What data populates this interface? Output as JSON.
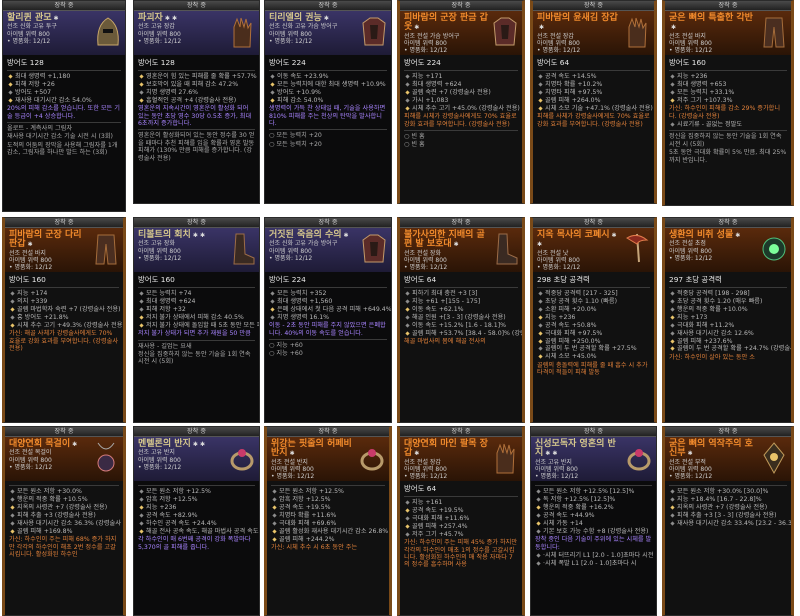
{
  "tab_label": "장착 중",
  "colors": {
    "unique": "#d4c68c",
    "legendary": "#f08a2c",
    "good": "#e8c46a",
    "aspect": "#e0803a",
    "blue": "#6aa8ff"
  },
  "cards": [
    {
      "name": "할리퀸 관모",
      "stars": "✱",
      "rarity": "u",
      "icon": "helm-icon",
      "sub": [
        "선조 신화 고유 투구",
        "아이템 위력 800",
        "• 명품화: 12/12"
      ],
      "armor": "방어도 128",
      "stats": [
        [
          "g",
          "최대 생명력 +1,180"
        ],
        [
          "g",
          "피해 저항 +26"
        ],
        [
          "",
          "방어도 +507"
        ],
        [
          "g",
          "재사용 대기시간 감소 54.0%"
        ],
        [
          "asp",
          "20%의 피해 감소를 얻습니다. 또한 모든 기술 등급이 +4 상승합니다."
        ]
      ],
      "extra": [
        "올로트 - 계측사의 그림자",
        "재사용 대기시간 감소 기술 시전 시 (3회)",
        "도적의 어둠의 장막을 사용해 그림자를 1개 감소, 그림자를 하나만 발드 하는 (3회)"
      ]
    },
    {
      "name": "파괴자",
      "stars": "✱ ✱",
      "rarity": "u",
      "icon": "glove-icon",
      "sub": [
        "선조 고유 장갑",
        "아이템 위력 800",
        "• 명품화: 12/12"
      ],
      "armor": "방어도 128",
      "stats": [
        [
          "g",
          "영혼운이 힘 있는 피해를 줄 확률 +57.7% (강령술사 전용)"
        ],
        [
          "g",
          "보호막이 있을 때 피해 감소 47.2%"
        ],
        [
          "",
          "치명 생명력 27.6%"
        ],
        [
          "g",
          "흡혈적인 공격 +4 (강령술사 전용)"
        ],
        [
          "asp",
          "영혼운의 지속시간이 영혼운이 활성화 되어 있는 동안 초당 영수 30당 0.5초 증가, 최대 6초까지 증가합니다."
        ]
      ],
      "extra": [
        "영혼운이 활성화되어 있는 동안 정수를 30 얻을 때마다 추천 피해를 입을 확률과 영혼 발동 피해가 (130% 만큼 피해를 증가합니다. (강령술사 전용)"
      ]
    },
    {
      "name": "티리엘의 권능",
      "stars": "✱",
      "rarity": "u",
      "icon": "armor-icon",
      "sub": [
        "선조 신화 고유 가슴 방어구",
        "아이템 위력 800",
        "• 명품화: 12/12"
      ],
      "armor": "방어도 224",
      "stats": [
        [
          "",
          "이동 속도 +23.9%"
        ],
        [
          "g",
          "모든 능력치에 대한 최대 생명력 +10.9%"
        ],
        [
          "",
          "방어도 +10.9%"
        ],
        [
          "g",
          "피해 감소 54.0%"
        ],
        [
          "asp",
          "생명력이 가득 찬 상태일 때, 기술을 사용하면 810% 피해를 주는 천상의 탄막을 발사합니다."
        ]
      ],
      "extra": [
        "○ 모든 능력치 +20",
        "○ 모든 능력치 +20"
      ]
    },
    {
      "name": "피바람의 군장 판금 갑옷",
      "stars": "✱",
      "rarity": "l",
      "icon": "armor-icon",
      "sub": [
        "선조 전설 가슴 방어구",
        "아이템 위력 800",
        "• 명품화: 12/12"
      ],
      "armor": "방어도 224",
      "stats": [
        [
          "",
          "지능 +171"
        ],
        [
          "",
          "최대 생명력 +624"
        ],
        [
          "g",
          "골렘 숙련 +7 (강령술사 전용)"
        ],
        [
          "",
          "가시 +1,083"
        ],
        [
          "g",
          "시체 추수 고기 +45.0% (강령술사 전용)"
        ],
        [
          "asp",
          "피해를 시체가 강령술사에게도 70% 효율로 강화 효과를 부여합니다. (강령술사 전용)"
        ]
      ],
      "extra": [
        "○ 빈 홈",
        "○ 빈 홈"
      ]
    },
    {
      "name": "피바람의 윤새김 장갑",
      "stars": "✱",
      "rarity": "l",
      "icon": "glove-icon",
      "sub": [
        "선조 전설 장갑",
        "아이템 위력 800",
        "• 명품화: 12/12"
      ],
      "armor": "방어도 64",
      "stats": [
        [
          "",
          "공격 속도 +14.5%"
        ],
        [
          "",
          "치명타 확률 +10.2%"
        ],
        [
          "",
          "치명타 피해 +97.5%"
        ],
        [
          "g",
          "골렘 피해 +264.0%"
        ],
        [
          "g",
          "시체 소모 기술 +47.1% (강령술사 전용)"
        ],
        [
          "asp",
          "피해를 사체가 강령술사에게도 70% 효율로 강화 효과를 부여합니다. (강령술사 전용)"
        ]
      ],
      "extra": []
    },
    {
      "name": "굳은 뼈의 특출한 각반",
      "stars": "✱",
      "rarity": "l",
      "icon": "pants-icon",
      "sub": [
        "선조 전설 바지",
        "아이템 위력 800",
        "• 명품화: 12/12"
      ],
      "armor": "방어도 160",
      "stats": [
        [
          "",
          "지능 +236"
        ],
        [
          "",
          "최대 생명력 +653"
        ],
        [
          "",
          "모든 능력치 +33.1%"
        ],
        [
          "g",
          "저주 그기 +107.3%"
        ],
        [
          "asp",
          "가신: 하수인이 피해를 감소 29% 증가합니다. (강령술사 전용)"
        ],
        [
          "",
          "시료기류 - 골없는 정말도"
        ]
      ],
      "extra": [
        "정신을 집중하지 않는 동안 기술을 1회 연속 시전 시 (5회)",
        "5초 동안 극대화 확률이 5% 만큼, 최대 25%까지 반입니다."
      ]
    },
    {
      "name": "피바람의 군장 다리 판갑",
      "stars": "✱",
      "rarity": "l",
      "icon": "pants-icon",
      "sub": [
        "선조 전설 바지",
        "아이템 위력 800",
        "• 명품화: 12/12"
      ],
      "armor": "방어도 160",
      "stats": [
        [
          "",
          "지능 +174"
        ],
        [
          "",
          "의지 +339"
        ],
        [
          "g",
          "골렘 마법학자 숙련 +7 (강령술사 전용)"
        ],
        [
          "",
          "흉 방어도 +21.8%"
        ],
        [
          "g",
          "시체 추수 고기 +49.3% (강령술사 전용)"
        ],
        [
          "asp",
          "가신: 해골 사체가 강령술사에게도 70% 효율로 강화 효과를 부여합니다. (강령술사 전용)"
        ]
      ],
      "extra": []
    },
    {
      "name": "티볼트의 회치",
      "stars": "✱ ✱",
      "rarity": "u",
      "icon": "boot-icon",
      "sub": [
        "선조 고유 장화",
        "아이템 위력 800",
        "• 명품화: 12/12"
      ],
      "armor": "방어도 160",
      "stats": [
        [
          "",
          "모든 능력치 +74"
        ],
        [
          "",
          "최대 생명력 +624"
        ],
        [
          "",
          "피해 저항 +32"
        ],
        [
          "g",
          "저지 불가 상태에서 피해 감소 40.5%"
        ],
        [
          "g",
          "저지 불가 상태에 돌입할 때 5초 동안 모든 피해가 20% 증가합니다."
        ],
        [
          "asp",
          "저지 불가 상태가 되면 추가 재원을 50 만큼"
        ]
      ],
      "extra": [
        "재사용 - 길업는 요새",
        "정신을 집중하지 않는 동안 기술을 1회 연속 시전 시 (5회)"
      ]
    },
    {
      "name": "거짓된 죽음의 수의",
      "stars": "✱",
      "rarity": "u",
      "icon": "armor-icon",
      "sub": [
        "선조 신화 고유 가슴 방어구",
        "아이템 위력 800",
        "• 명품화: 12/12"
      ],
      "armor": "방어도 224",
      "stats": [
        [
          "",
          "모든 능력치 +352"
        ],
        [
          "",
          "최대 생명력 +1,560"
        ],
        [
          "g",
          "은폐 상태에서 첫 다음 공격 피해 +649.4%"
        ],
        [
          "",
          "치명 생명력 16.1%"
        ],
        [
          "asp",
          "이동 - 2초 동안 피해를 주지 않았으면 은폐합니다. 40%의 이동 속도를 얻습니다."
        ]
      ],
      "extra": [
        "○ 지능 +60",
        "○ 지능 +60"
      ]
    },
    {
      "name": "불가사의한 지배의 골편 발 보호대",
      "stars": "✱",
      "rarity": "l",
      "icon": "boot-icon",
      "sub": [
        "선조 전설 장화",
        "아이템 위력 800",
        "• 명품화: 12/12"
      ],
      "armor": "방어도 64",
      "stats": [
        [
          "",
          "피하기 최대 충전 +3 [3]"
        ],
        [
          "",
          "지능 +61 +[155 - 175]"
        ],
        [
          "g",
          "이동 속도 +62.1%"
        ],
        [
          "",
          "해골 인원 +[3 - 3] (강령술사 전용)"
        ],
        [
          "",
          "이동 속도 +15.2% [1.6 - 18.1]%"
        ],
        [
          "g",
          "골렘 피해 +53.7% [38.4 - 58.0]% (강령술사 전용)"
        ],
        [
          "asp",
          "해골 마법사의 몸에 해골 전사의"
        ]
      ],
      "extra": []
    },
    {
      "name": "지옥 목사의 코폐시",
      "stars": "✱ ✱",
      "rarity": "l",
      "icon": "weapon-icon",
      "sub": [
        "선조 전설 낫",
        "아이템 위력 800",
        "• 명품화: 12/12"
      ],
      "armor": "298 초당 공격력",
      "stats": [
        [
          "",
          "적중당 공격력 [217 - 325]"
        ],
        [
          "",
          "초당 공격 횟수 1.10 (빠름)"
        ],
        [
          "",
          "소환 피해 +20.0%"
        ],
        [
          "g",
          "지능 +236"
        ],
        [
          "",
          "공격 속도 +50.8%"
        ],
        [
          "g",
          "극대화 피해 +97.5%"
        ],
        [
          "g",
          "골렘 피해 +250.0%"
        ],
        [
          "",
          "골렘이 두 번 공격할 확률 +27.5%"
        ],
        [
          "g",
          "시체 소모 +45.0%"
        ],
        [
          "asp",
          "골렘의 충돌력에 피해를 줄 때 흡수 시 추가 타격이 적들이 피해 발동"
        ]
      ],
      "extra": []
    },
    {
      "name": "생환의 비취 성물",
      "stars": "✱",
      "rarity": "l",
      "icon": "focus-icon",
      "sub": [
        "선조 전설 초점",
        "아이템 위력 800",
        "• 명품화: 12/12"
      ],
      "armor": "297 초당 공격력",
      "stats": [
        [
          "",
          "적중당 공격력 [198 - 298]"
        ],
        [
          "",
          "초당 공격 횟수 1.20 (매우 빠름)"
        ],
        [
          "",
          "행운의 적중 확률 +10.0%"
        ],
        [
          "g",
          "지능 +173"
        ],
        [
          "",
          "극대화 피해 +11.2%"
        ],
        [
          "",
          "재사용 대기시간 감소 12.6%"
        ],
        [
          "g",
          "골렘 피해 +237.6%"
        ],
        [
          "g",
          "골렘이 두 번 공격할 확률 +24.7% (강령술사 전용)"
        ],
        [
          "asp",
          "가신: 하수인이 살아 있는 동안 소"
        ]
      ],
      "extra": []
    },
    {
      "name": "대양연회 목걸이",
      "stars": "✱",
      "rarity": "l",
      "icon": "amulet-icon",
      "sub": [
        "선조 전설 목걸이",
        "아이템 위력 800",
        "• 명품화: 12/12"
      ],
      "armor": "",
      "stats": [
        [
          "",
          "모든 원소 저항 +30.0%"
        ],
        [
          "",
          "행운의 적중 확률 +10.5%"
        ],
        [
          "g",
          "지옥의 사령관 +7 (강령술사 전용)"
        ],
        [
          "",
          "피해 추출 +3 (강령술사 전용)"
        ],
        [
          "",
          "재사용 대기시간 감소 36.3% (강령술사 전용)"
        ],
        [
          "g",
          "골렘 피해 +169.8%"
        ],
        [
          "asp",
          "가신: 하수인이 주는 피해 68% 증가 하지만 각각의 하수인이 해초 2번 정수를 고갈시킵니다. 활성화된 하수인"
        ]
      ],
      "extra": []
    },
    {
      "name": "멘텔론의 반지",
      "stars": "✱ ✱",
      "rarity": "u",
      "icon": "ring-icon",
      "sub": [
        "선조 고유 반지",
        "아이템 위력 800",
        "• 명품화: 12/12"
      ],
      "armor": "",
      "stats": [
        [
          "",
          "모든 원소 저항 +12.5%"
        ],
        [
          "",
          "암흑 저항 +12.5%"
        ],
        [
          "g",
          "지능 +236"
        ],
        [
          "",
          "공격 속도 +82.9%"
        ],
        [
          "",
          "하수인 공격 속도 +24.4%"
        ],
        [
          "g",
          "해골 전사 공속 속도, 해골 마법사 공격 속도 +3 (강령술사 전용)"
        ],
        [
          "asp",
          "각 하수인이 매 6번째 공격이 강화 폭발마다 5,370의 골 피해를 줍니다."
        ]
      ],
      "extra": []
    },
    {
      "name": "위강는 핏줄의 허페비 반지",
      "stars": "✱",
      "rarity": "l",
      "icon": "ring-icon",
      "sub": [
        "선조 전설 반지",
        "아이템 위력 800",
        "• 명품화: 12/12"
      ],
      "armor": "",
      "stats": [
        [
          "",
          "모든 원소 저항 +12.5%"
        ],
        [
          "",
          "암흑 저항 +12.5%"
        ],
        [
          "g",
          "공격 속도 +19.5%"
        ],
        [
          "",
          "치명타 확률 +11.6%"
        ],
        [
          "",
          "극대화 피해 +69.6%"
        ],
        [
          "g",
          "골렘 활성화 재사용 대기시간 감소 26.8% (강령술사 전용)"
        ],
        [
          "g",
          "골렘 피해 +244.2%"
        ],
        [
          "asp",
          "가신: 시체 추수 시 6초 동안 주는"
        ]
      ],
      "extra": []
    },
    {
      "name": "대양연회 마인 팔목 장갑",
      "stars": "✱",
      "rarity": "l",
      "icon": "glove-icon",
      "sub": [
        "선조 전설 장갑",
        "아이템 위력 800",
        "• 명품화: 12/12"
      ],
      "armor": "방어도 64",
      "stats": [
        [
          "",
          "지능 +161"
        ],
        [
          "g",
          "공격 속도 +19.5%"
        ],
        [
          "",
          "극대화 피해 +11.6%"
        ],
        [
          "g",
          "골렘 피해 +257.4%"
        ],
        [
          "",
          "저주 그기 +45.7%"
        ],
        [
          "asp",
          "가신: 하수인이 주는 피해 45% 증가 하지만 각각의 하수인이 매초 1의 정수를 고갈시킵니다. 활성화된 하수인의 매 착용 자마다 7의 정수를 흡수하며 사용"
        ]
      ],
      "extra": []
    },
    {
      "name": "신성모독자 영혼의 반지",
      "stars": "✱ ✱",
      "rarity": "u",
      "icon": "ring-icon",
      "sub": [
        "선조 고유 반지",
        "아이템 위력 800",
        "• 명품화: 12/12"
      ],
      "armor": "",
      "stats": [
        [
          "",
          "모든 원소 저항 +12.5% [12.5]%"
        ],
        [
          "",
          "독 저항 +12.5% [12.5]%"
        ],
        [
          "g",
          "행운의 적중 확률 +16.2%"
        ],
        [
          "",
          "공격 속도 +44.9%"
        ],
        [
          "g",
          "시체 가동 +14"
        ],
        [
          "",
          "기본 보호 가능 수함 +8 (강령술사 전용)"
        ],
        [
          "asp",
          "장착 중인 다음 기술이 주위에 있는 시체를 발동합니다:"
        ],
        [
          "",
          "·시체 터뜨리기 L1 [2.0 - 1.0]초마다 시전"
        ],
        [
          "",
          "·시체 폭발 L1 [2.0 - 1.0]초마다 시"
        ]
      ],
      "extra": []
    },
    {
      "name": "굳은 뼈의 역작주의 호신부",
      "stars": "✱",
      "rarity": "l",
      "icon": "talisman-icon",
      "sub": [
        "선조 전설 부적",
        "아이템 위력 800",
        "• 명품화: 12/12"
      ],
      "armor": "",
      "stats": [
        [
          "",
          "모든 원소 저항 +30.0% [30.0]%"
        ],
        [
          "",
          "지능 +18.4% [16.7 - 22.8]%"
        ],
        [
          "g",
          "지옥의 사령관 +7 (강령술사 전용)"
        ],
        [
          "",
          "피해 추출 +3 [3 - 3] (강령술사 전용)"
        ],
        [
          "",
          "재사용 대기시간 감소 33.4% [23.2 - 36.3]% (강령술사 전용)"
        ]
      ],
      "extra": []
    }
  ]
}
